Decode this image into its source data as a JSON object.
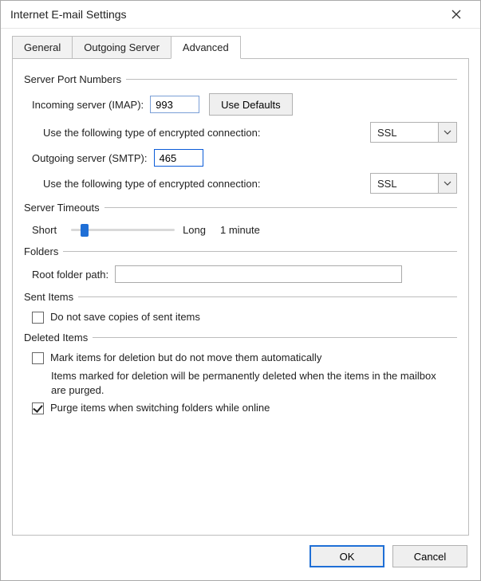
{
  "window": {
    "title": "Internet E-mail Settings"
  },
  "tabs": {
    "general": "General",
    "outgoing": "Outgoing Server",
    "advanced": "Advanced"
  },
  "groups": {
    "server_port_numbers": "Server Port Numbers",
    "server_timeouts": "Server Timeouts",
    "folders": "Folders",
    "sent_items": "Sent Items",
    "deleted_items": "Deleted Items"
  },
  "labels": {
    "incoming_imap": "Incoming server (IMAP):",
    "use_defaults": "Use Defaults",
    "encryption_type": "Use the following type of encrypted connection:",
    "outgoing_smtp": "Outgoing server (SMTP):",
    "short": "Short",
    "long": "Long",
    "timeout_value": "1 minute",
    "root_folder_path": "Root folder path:",
    "do_not_save_sent": "Do not save copies of sent items",
    "mark_for_deletion": "Mark items for deletion but do not move them automatically",
    "mark_hint": "Items marked for deletion will be permanently deleted when the items in the mailbox are purged.",
    "purge_on_switch": "Purge items when switching folders while online"
  },
  "values": {
    "incoming_port": "993",
    "incoming_encryption": "SSL",
    "outgoing_port": "465",
    "outgoing_encryption": "SSL",
    "root_folder": "",
    "do_not_save_sent_checked": false,
    "mark_for_deletion_checked": false,
    "purge_on_switch_checked": true
  },
  "footer": {
    "ok": "OK",
    "cancel": "Cancel"
  }
}
